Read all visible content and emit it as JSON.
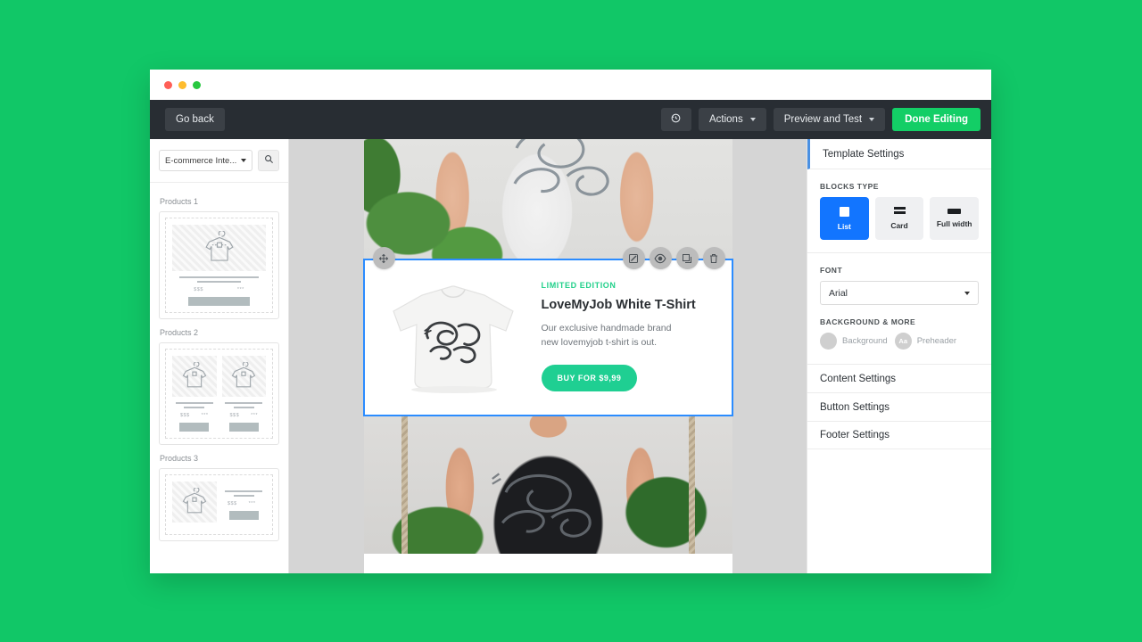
{
  "window": {
    "traffic_lights": [
      "close",
      "minimize",
      "maximize"
    ]
  },
  "toolbar": {
    "go_back_label": "Go back",
    "history_icon": "history-undo-icon",
    "actions_label": "Actions",
    "preview_label": "Preview and Test",
    "done_label": "Done Editing",
    "accent_green": "#13ce66"
  },
  "left_panel": {
    "category_value": "E-commerce Inte...",
    "search_icon": "search-icon",
    "groups": [
      {
        "title": "Products 1",
        "layout": "single",
        "columns": [
          {
            "price_left": "$$$",
            "price_right": "***"
          }
        ]
      },
      {
        "title": "Products 2",
        "layout": "double",
        "columns": [
          {
            "price_left": "$$$",
            "price_right": "***"
          },
          {
            "price_left": "$$$",
            "price_right": "***"
          }
        ]
      },
      {
        "title": "Products 3",
        "layout": "horizontal",
        "columns": [
          {
            "price_left": "$$$",
            "price_right": "***"
          }
        ]
      }
    ]
  },
  "canvas": {
    "photo_top_alt": "woman wearing white LoveMyJob tank top with plants",
    "photo_bottom_alt": "man on swing wearing black LoveMyJob t-shirt",
    "block_tools_left": [
      {
        "icon": "move-handle-icon",
        "name": "drag-block"
      }
    ],
    "block_tools_right": [
      {
        "icon": "edit-icon",
        "name": "edit-block"
      },
      {
        "icon": "eye-icon",
        "name": "preview-block"
      },
      {
        "icon": "duplicate-icon",
        "name": "duplicate-block"
      },
      {
        "icon": "trash-icon",
        "name": "delete-block"
      }
    ],
    "product": {
      "eyebrow": "LIMITED EDITION",
      "title": "LoveMyJob White T-Shirt",
      "description": "Our exclusive handmade brand new lovemyjob t-shirt is out.",
      "button_label": "BUY FOR $9,99",
      "eyebrow_color": "#21d08a",
      "button_color": "#1fcf92",
      "shirt_art": "#LoveMyJob script logo"
    }
  },
  "right_panel": {
    "header": "Template Settings",
    "blocks_type_label": "BLOCKS TYPE",
    "blocks_types": [
      {
        "label": "List",
        "icon": "block-list-icon",
        "active": true
      },
      {
        "label": "Card",
        "icon": "block-card-icon",
        "active": false
      },
      {
        "label": "Full width",
        "icon": "block-fullwidth-icon",
        "active": false
      }
    ],
    "font_label": "FONT",
    "font_value": "Arial",
    "background_label": "BACKGROUND & MORE",
    "background_items": [
      {
        "label": "Background",
        "icon": "color-swatch-icon"
      },
      {
        "label": "Preheader",
        "icon": "preheader-aa-icon",
        "glyph": "Aa"
      }
    ],
    "settings_rows": [
      "Content Settings",
      "Button Settings",
      "Footer Settings"
    ],
    "active_accent": "#1275ff",
    "header_accent": "#4a90e2"
  },
  "page": {
    "background_color": "#11c767"
  }
}
